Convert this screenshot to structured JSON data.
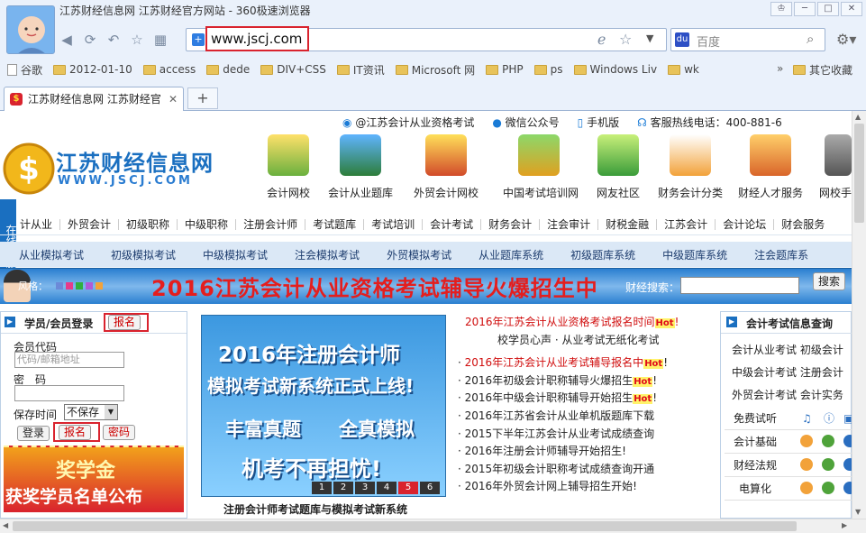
{
  "window": {
    "title": "江苏财经信息网 江苏财经官方网站 - 360极速浏览器"
  },
  "browser": {
    "url": "www.jscj.com",
    "search_placeholder": "百度",
    "bookmarks": [
      "谷歌",
      "2012-01-10",
      "access",
      "dede",
      "DIV+CSS",
      "IT资讯",
      "Microsoft 网",
      "PHP",
      "ps",
      "Windows Liv",
      "wk"
    ],
    "bookmarks_more": "»",
    "other_bookmarks": "其它收藏",
    "tab_title": "江苏财经信息网 江苏财经官",
    "new_tab": "+"
  },
  "site": {
    "top_links": [
      "@江苏会计从业资格考试",
      "微信公众号",
      "手机版",
      "客服热线电话：400-881-6"
    ],
    "logo_text": "江苏财经信息网",
    "logo_url": "WWW.JSCJ.COM",
    "icons": [
      "会计网校",
      "会计从业题库",
      "外贸会计网校",
      "中国考试培训网",
      "网友社区",
      "财务会计分类",
      "财经人才服务",
      "网校手"
    ],
    "side_service": "在线客服",
    "nav1": [
      "计从业",
      "外贸会计",
      "初级职称",
      "中级职称",
      "注册会计师",
      "考试题库",
      "考试培训",
      "会计考试",
      "财务会计",
      "注会审计",
      "财税金融",
      "江苏会计",
      "会计论坛",
      "财会服务"
    ],
    "nav2": [
      "从业模拟考试",
      "初级模拟考试",
      "中级模拟考试",
      "注会模拟考试",
      "外贸模拟考试",
      "从业题库系统",
      "初级题库系统",
      "中级题库系统",
      "注会题库系"
    ],
    "banner": {
      "style_label": "风格：",
      "text": "2016江苏会计从业资格考试辅导火爆招生中",
      "search_label": "财经搜索：",
      "search_button": "搜索"
    },
    "login": {
      "title": "学员/会员登录",
      "register": "报名",
      "member_code_label": "会员代码",
      "member_code_placeholder": "代码/邮箱地址",
      "password_label": "密　码",
      "save_label": "保存时间",
      "save_value": "不保存",
      "login_button": "登录",
      "register_button": "报名",
      "password_button": "密码"
    },
    "scholarship": {
      "line1": "奖学金",
      "line2": "获奖学员名单公布"
    },
    "feature": {
      "line1": "2016年注册会计师",
      "line2": "模拟考试新系统正式上线!",
      "line3": "丰富真题　　全真模拟",
      "line4": "机考不再担忧!",
      "pages": [
        "1",
        "2",
        "3",
        "4",
        "5",
        "6"
      ],
      "caption": "注册会计师考试题库与模拟考试新系统"
    },
    "news": {
      "headline": "2016年江苏会计从业资格考试报名时间",
      "headline_suffix": "!",
      "sub": "校学员心声 · 从业考试无纸化考试",
      "hot": "Hot",
      "items": [
        {
          "text": "2016年江苏会计从业考试辅导报名中",
          "red": true,
          "hot": true
        },
        {
          "text": "2016年初级会计职称辅导火爆招生",
          "red": false,
          "hot": true
        },
        {
          "text": "2016年中级会计职称辅导开始招生",
          "red": false,
          "hot": true
        },
        {
          "text": "2016年江苏省会计从业单机版题库下载",
          "red": false,
          "hot": false
        },
        {
          "text": "2015下半年江苏会计从业考试成绩查询",
          "red": false,
          "hot": false
        },
        {
          "text": "2016年注册会计师辅导开始招生!",
          "red": false,
          "hot": false
        },
        {
          "text": "2015年初级会计职称考试成绩查询开通",
          "red": false,
          "hot": false
        },
        {
          "text": "2016年外贸会计网上辅导招生开始!",
          "red": false,
          "hot": false
        }
      ]
    },
    "exam_info": {
      "title": "会计考试信息查询",
      "rows": [
        [
          "会计从业考试",
          "初级会计"
        ],
        [
          "中级会计考试",
          "注册会计"
        ],
        [
          "外贸会计考试",
          "会计实务"
        ]
      ],
      "trial_title": "免费试听",
      "trial": [
        "会计基础",
        "财经法规",
        "电算化"
      ]
    }
  }
}
